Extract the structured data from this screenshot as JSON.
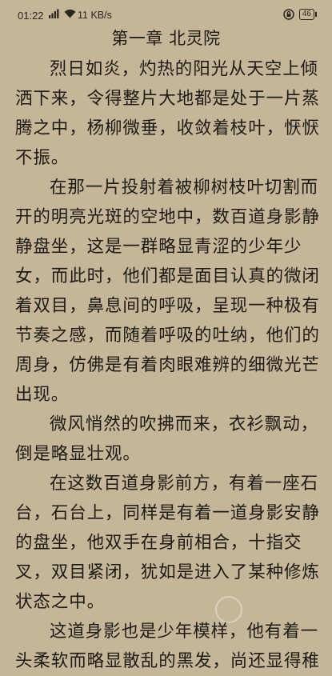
{
  "status_bar": {
    "time": "01:22",
    "network_speed": "11 KB/s",
    "battery": "46"
  },
  "chapter": {
    "title": "第一章 北灵院"
  },
  "paragraphs": [
    "烈日如炎，灼热的阳光从天空上倾洒下来，令得整片大地都是处于一片蒸腾之中，杨柳微垂，收敛着枝叶，恹恹不振。",
    "在那一片投射着被柳树枝叶切割而开的明亮光斑的空地中，数百道身影静静盘坐，这是一群略显青涩的少年少女，而此时，他们都是面目认真的微闭着双目，鼻息间的呼吸，呈现一种极有节奏之感，而随着呼吸的吐纳，他们的周身，仿佛是有着肉眼难辨的细微光芒出现。",
    "微风悄然的吹拂而来，衣衫飘动，倒是略显壮观。",
    "在这数百道身影前方，有着一座石台，石台上，同样是有着一道身影安静的盘坐，他双手在身前相合，十指交叉，双目紧闭，犹如是进入了某种修炼状态之中。",
    "这道身影也是少年模样，他有着一头柔软而略显散乱的黑发，尚还显得稚"
  ],
  "icons": {
    "signal": "cellular-signal-icon",
    "wifi": "wifi-icon",
    "rotation_lock": "rotation-lock-icon",
    "battery": "battery-icon"
  }
}
